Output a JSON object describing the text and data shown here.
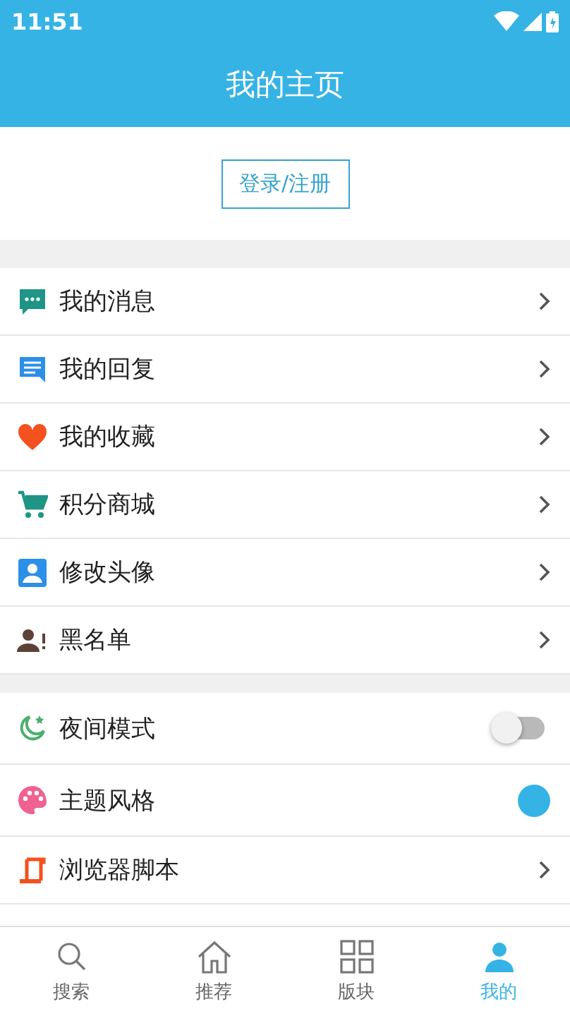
{
  "status_bar": {
    "time": "11:51"
  },
  "header": {
    "title": "我的主页"
  },
  "login_button": "登录/注册",
  "groups": [
    {
      "items": [
        {
          "kind": "link",
          "label": "我的消息"
        },
        {
          "kind": "link",
          "label": "我的回复"
        },
        {
          "kind": "link",
          "label": "我的收藏"
        },
        {
          "kind": "link",
          "label": "积分商城"
        },
        {
          "kind": "link",
          "label": "修改头像"
        },
        {
          "kind": "link",
          "label": "黑名单"
        }
      ]
    },
    {
      "items": [
        {
          "kind": "toggle",
          "label": "夜间模式",
          "on": false
        },
        {
          "kind": "color",
          "label": "主题风格",
          "color": "#35b3e5"
        },
        {
          "kind": "link",
          "label": "浏览器脚本"
        }
      ]
    }
  ],
  "bottom_nav": [
    {
      "label": "搜索",
      "selected": false
    },
    {
      "label": "推荐",
      "selected": false
    },
    {
      "label": "版块",
      "selected": false
    },
    {
      "label": "我的",
      "selected": true
    }
  ]
}
